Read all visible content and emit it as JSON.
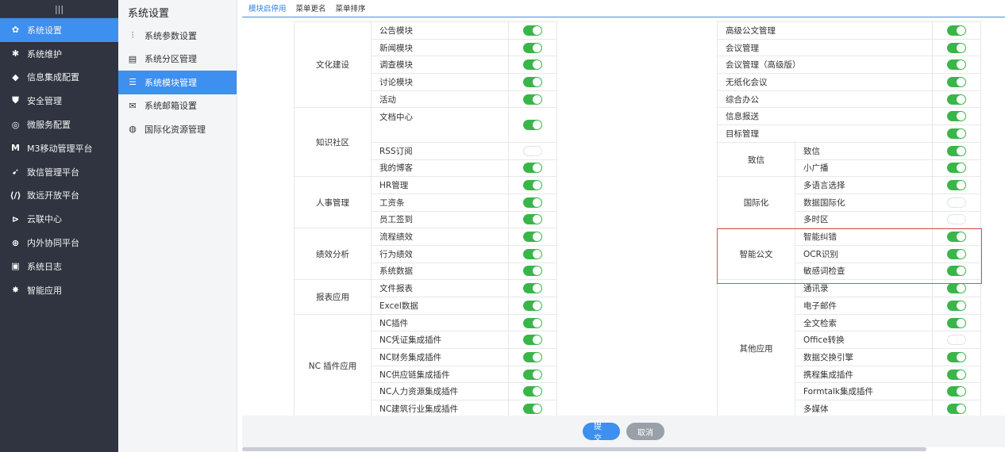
{
  "nav": {
    "toggle": "|||",
    "items": [
      {
        "label": "系统设置",
        "icon": "gear-icon",
        "glyph": "✿",
        "active": true
      },
      {
        "label": "系统维护",
        "icon": "maintenance-icon",
        "glyph": "✱"
      },
      {
        "label": "信息集成配置",
        "icon": "integration-icon",
        "glyph": "◆"
      },
      {
        "label": "安全管理",
        "icon": "shield-icon",
        "glyph": "⛊"
      },
      {
        "label": "微服务配置",
        "icon": "microservice-icon",
        "glyph": "◎"
      },
      {
        "label": "M3移动管理平台",
        "icon": "m3-icon",
        "glyph": "M"
      },
      {
        "label": "致信管理平台",
        "icon": "zhixin-icon",
        "glyph": "➹"
      },
      {
        "label": "致远开放平台",
        "icon": "code-icon",
        "glyph": "⟨/⟩"
      },
      {
        "label": "云联中心",
        "icon": "cloud-link-icon",
        "glyph": "⊳"
      },
      {
        "label": "内外协同平台",
        "icon": "collab-icon",
        "glyph": "⊛"
      },
      {
        "label": "系统日志",
        "icon": "monitor-icon",
        "glyph": "▣"
      },
      {
        "label": "智能应用",
        "icon": "bulb-icon",
        "glyph": "✸"
      }
    ]
  },
  "sub": {
    "title": "系统设置",
    "items": [
      {
        "label": "系统参数设置",
        "icon": "sliders-icon",
        "glyph": "⫶"
      },
      {
        "label": "系统分区管理",
        "icon": "partition-icon",
        "glyph": "▤"
      },
      {
        "label": "系统模块管理",
        "icon": "list-icon",
        "glyph": "☰",
        "active": true
      },
      {
        "label": "系统邮箱设置",
        "icon": "mail-icon",
        "glyph": "✉"
      },
      {
        "label": "国际化资源管理",
        "icon": "globe-icon",
        "glyph": "◍"
      }
    ]
  },
  "tabs": [
    "模块启停用",
    "菜单更名",
    "菜单排序"
  ],
  "left_groups": [
    {
      "name": "文化建设",
      "modules": [
        {
          "label": "公告模块",
          "on": true
        },
        {
          "label": "新闻模块",
          "on": true
        },
        {
          "label": "调查模块",
          "on": true
        },
        {
          "label": "讨论模块",
          "on": true
        },
        {
          "label": "活动",
          "on": true
        }
      ]
    },
    {
      "name": "知识社区",
      "modules": [
        {
          "label": "文档中心",
          "on": true,
          "rows": 2
        },
        {
          "label": "RSS订阅",
          "on": false
        },
        {
          "label": "我的博客",
          "on": true
        }
      ]
    },
    {
      "name": "人事管理",
      "modules": [
        {
          "label": "HR管理",
          "on": true
        },
        {
          "label": "工资条",
          "on": true
        },
        {
          "label": "员工签到",
          "on": true
        }
      ]
    },
    {
      "name": "绩效分析",
      "modules": [
        {
          "label": "流程绩效",
          "on": true
        },
        {
          "label": "行为绩效",
          "on": true
        },
        {
          "label": "系统数据",
          "on": true
        }
      ]
    },
    {
      "name": "报表应用",
      "modules": [
        {
          "label": "文件报表",
          "on": true
        },
        {
          "label": "Excel数据",
          "on": true
        }
      ]
    },
    {
      "name": "NC 插件应用",
      "modules": [
        {
          "label": "NC插件",
          "on": true
        },
        {
          "label": "NC凭证集成插件",
          "on": true
        },
        {
          "label": "NC财务集成插件",
          "on": true
        },
        {
          "label": "NC供应链集成插件",
          "on": true
        },
        {
          "label": "NC人力资源集成插件",
          "on": true
        },
        {
          "label": "NC建筑行业集成插件",
          "on": true
        }
      ]
    }
  ],
  "right_groups": [
    {
      "name": "",
      "label": "高级公文管理",
      "on": true
    },
    {
      "name": "",
      "label": "会议管理",
      "on": true
    },
    {
      "name": "",
      "label": "会议管理（高级版）",
      "on": true
    },
    {
      "name": "",
      "label": "无纸化会议",
      "on": true
    },
    {
      "name": "",
      "label": "综合办公",
      "on": true
    },
    {
      "name": "",
      "label": "信息报送",
      "on": true
    },
    {
      "name": "",
      "label": "目标管理",
      "on": true
    },
    {
      "name": "致信",
      "modules": [
        {
          "label": "致信",
          "on": true
        },
        {
          "label": "小广播",
          "on": true
        }
      ]
    },
    {
      "name": "国际化",
      "modules": [
        {
          "label": "多语言选择",
          "on": true
        },
        {
          "label": "数据国际化",
          "on": false
        },
        {
          "label": "多时区",
          "on": false
        }
      ]
    },
    {
      "name": "智能公文",
      "modules": [
        {
          "label": "智能纠错",
          "on": true
        },
        {
          "label": "OCR识别",
          "on": true
        },
        {
          "label": "敏感词检查",
          "on": true
        }
      ]
    },
    {
      "name": "其他应用",
      "modules": [
        {
          "label": "通讯录",
          "on": true
        },
        {
          "label": "电子邮件",
          "on": true
        },
        {
          "label": "全文检索",
          "on": true
        },
        {
          "label": "Office转换",
          "on": false
        },
        {
          "label": "数据交换引擎",
          "on": true
        },
        {
          "label": "携程集成插件",
          "on": true
        },
        {
          "label": "Formtalk集成插件",
          "on": true
        },
        {
          "label": "多媒体",
          "on": true
        }
      ]
    }
  ],
  "buttons": {
    "submit": "提交",
    "cancel": "取消"
  },
  "colors": {
    "accent": "#3d8ff0",
    "toggle_on": "#3ab54a",
    "highlight": "#e84c4c",
    "nav_bg": "#2f3440"
  }
}
